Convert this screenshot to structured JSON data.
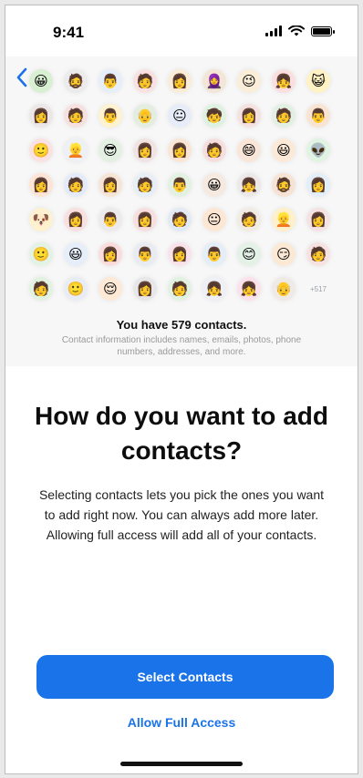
{
  "status_bar": {
    "time": "9:41"
  },
  "nav": {
    "back_icon": "chevron-left-icon"
  },
  "avatars": [
    {
      "glyph": "😀",
      "bg": "#d8efd2"
    },
    {
      "glyph": "🧔",
      "bg": "#eceaea"
    },
    {
      "glyph": "👨",
      "bg": "#e6eef9"
    },
    {
      "glyph": "🧑",
      "bg": "#f9e1e1"
    },
    {
      "glyph": "👩",
      "bg": "#fbecd6"
    },
    {
      "glyph": "🧕",
      "bg": "#f3e6d6"
    },
    {
      "glyph": "😉",
      "bg": "#fbeed9"
    },
    {
      "glyph": "👧",
      "bg": "#fbdede"
    },
    {
      "glyph": "😺",
      "bg": "#fff2c4"
    },
    {
      "glyph": "👩",
      "bg": "#ece6e6"
    },
    {
      "glyph": "🧑",
      "bg": "#f7e0e0"
    },
    {
      "glyph": "👨",
      "bg": "#fff2cf"
    },
    {
      "glyph": "👴",
      "bg": "#e3eee0"
    },
    {
      "glyph": "😐",
      "bg": "#e7ecf9"
    },
    {
      "glyph": "🧒",
      "bg": "#dff2e1"
    },
    {
      "glyph": "👩",
      "bg": "#f6e1e1"
    },
    {
      "glyph": "🧑",
      "bg": "#e1f0e2"
    },
    {
      "glyph": "👨",
      "bg": "#f9e4d2"
    },
    {
      "glyph": "🙂",
      "bg": "#fbe2e2"
    },
    {
      "glyph": "👱",
      "bg": "#eef0f6"
    },
    {
      "glyph": "😎",
      "bg": "#e4f1e2"
    },
    {
      "glyph": "👩",
      "bg": "#f2e3e3"
    },
    {
      "glyph": "👩",
      "bg": "#fbe6d6"
    },
    {
      "glyph": "🧑",
      "bg": "#f7dede"
    },
    {
      "glyph": "😄",
      "bg": "#f9e6d8"
    },
    {
      "glyph": "😃",
      "bg": "#fde9d8"
    },
    {
      "glyph": "👽",
      "bg": "#e1f3e1"
    },
    {
      "glyph": "👩",
      "bg": "#fde4d4"
    },
    {
      "glyph": "🧑",
      "bg": "#e3ebfa"
    },
    {
      "glyph": "👩",
      "bg": "#f6e5d5"
    },
    {
      "glyph": "🧑",
      "bg": "#e6eef6"
    },
    {
      "glyph": "👨",
      "bg": "#e3f1e3"
    },
    {
      "glyph": "😀",
      "bg": "#f6e9e0"
    },
    {
      "glyph": "👧",
      "bg": "#ece8e8"
    },
    {
      "glyph": "🧔",
      "bg": "#f6e3d4"
    },
    {
      "glyph": "👩",
      "bg": "#e2eef8"
    },
    {
      "glyph": "🐶",
      "bg": "#fdf1d0"
    },
    {
      "glyph": "👩",
      "bg": "#f8e0e0"
    },
    {
      "glyph": "👨",
      "bg": "#eceaea"
    },
    {
      "glyph": "👩",
      "bg": "#f7dfdf"
    },
    {
      "glyph": "🧑",
      "bg": "#e2eaf6"
    },
    {
      "glyph": "😐",
      "bg": "#fde7d3"
    },
    {
      "glyph": "🧑",
      "bg": "#f1ebe3"
    },
    {
      "glyph": "👱",
      "bg": "#fff0cb"
    },
    {
      "glyph": "👩",
      "bg": "#f5e2e2"
    },
    {
      "glyph": "🙂",
      "bg": "#e2f2e4"
    },
    {
      "glyph": "😃",
      "bg": "#e6eefa"
    },
    {
      "glyph": "👩",
      "bg": "#fbdcdc"
    },
    {
      "glyph": "👨",
      "bg": "#e8ecf2"
    },
    {
      "glyph": "👩",
      "bg": "#fae2ea"
    },
    {
      "glyph": "👨",
      "bg": "#e3eef9"
    },
    {
      "glyph": "😊",
      "bg": "#e3f1e7"
    },
    {
      "glyph": "😏",
      "bg": "#fbe9d6"
    },
    {
      "glyph": "🧑",
      "bg": "#f7e2e2"
    },
    {
      "glyph": "🧑",
      "bg": "#e1f2e0"
    },
    {
      "glyph": "🙂",
      "bg": "#e8ecf4"
    },
    {
      "glyph": "😌",
      "bg": "#fde9d6"
    },
    {
      "glyph": "👩",
      "bg": "#e7e7e7"
    },
    {
      "glyph": "🧑",
      "bg": "#e1f2e1"
    },
    {
      "glyph": "👧",
      "bg": "#eef0f6"
    },
    {
      "glyph": "👧",
      "bg": "#fde1ea"
    },
    {
      "glyph": "👴",
      "bg": "#efeae6"
    }
  ],
  "avatars_more": "+517",
  "contacts": {
    "count_label": "You have 579 contacts.",
    "info": "Contact information includes names, emails, photos, phone numbers, addresses, and more."
  },
  "main": {
    "title": "How do you want to add contacts?",
    "description": "Selecting contacts lets you pick the ones you want to add right now. You can always add more later. Allowing full access will add all of your contacts."
  },
  "actions": {
    "primary_label": "Select Contacts",
    "secondary_label": "Allow Full Access"
  },
  "colors": {
    "accent": "#1a73e8"
  }
}
